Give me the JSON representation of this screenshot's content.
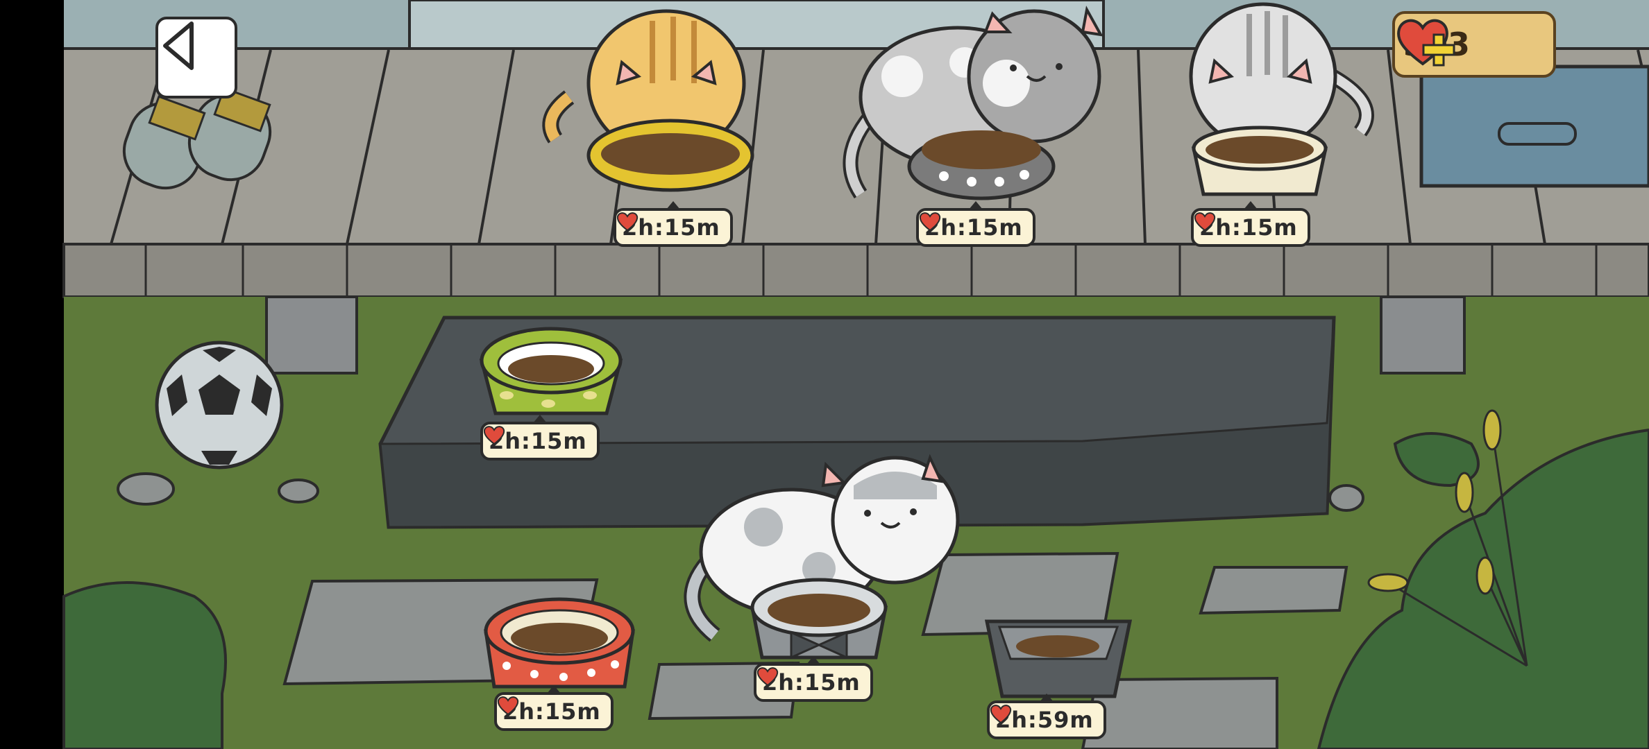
{
  "hud": {
    "back_icon": "back-triangle-icon",
    "hearts_icon": "heart-plus-icon",
    "hearts_count": "303"
  },
  "bowls": [
    {
      "id": "yellow-bowl-deck",
      "timer": "2h:15m"
    },
    {
      "id": "gray-dotted-bowl-deck",
      "timer": "2h:15m"
    },
    {
      "id": "cream-bowl-deck",
      "timer": "2h:15m"
    },
    {
      "id": "green-leaf-bowl-stone",
      "timer": "2h:15m"
    },
    {
      "id": "red-polkadot-bowl",
      "timer": "2h:15m"
    },
    {
      "id": "gray-bowtie-bowl",
      "timer": "2h:15m"
    },
    {
      "id": "square-gray-bowl",
      "timer": "2h:59m"
    }
  ],
  "colors": {
    "grass": "#5e7a3a",
    "deck": "#9a9890",
    "stone": "#4d5356",
    "timer_bg": "#fbf3d6",
    "heart": "#e04b3c",
    "counter_bg": "#e8c77e"
  }
}
